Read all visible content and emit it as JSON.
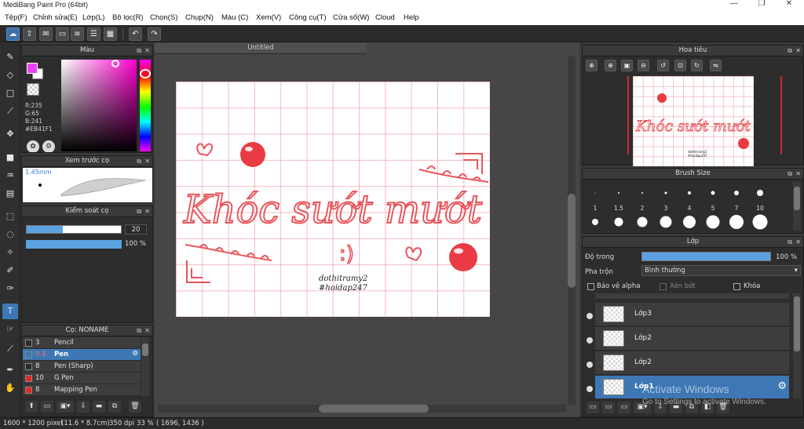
{
  "window": {
    "title": "MediBang Paint Pro (64bit)"
  },
  "menu": [
    "Tệp(F)",
    "Chỉnh sửa(E)",
    "Lớp(L)",
    "Bộ lọc(R)",
    "Chọn(S)",
    "Chụp(N)",
    "Màu (C)",
    "Xem(V)",
    "Công cụ(T)",
    "Cửa sổ(W)",
    "Cloud",
    "Help"
  ],
  "document": {
    "tab_title": "Untitled"
  },
  "color_panel": {
    "title": "Màu",
    "r": "R:235",
    "g": "G:65",
    "b": "B:241",
    "hex": "#EB41F1",
    "foreground": "#EB41F1"
  },
  "brush_preview": {
    "title": "Xem trước cọ",
    "size": "1.45mm"
  },
  "brush_control": {
    "title": "Kiểm soát cọ",
    "size_value": "20",
    "size_level": 0.38,
    "opacity_value": "100 %",
    "opacity_level": 1.0
  },
  "brush_list": {
    "title": "Cọ: NONAME",
    "items": [
      {
        "size": "3",
        "name": "Pencil",
        "color": "#2b2b2b"
      },
      {
        "size": "0.4",
        "name": "Pen",
        "color": "#3d78b5"
      },
      {
        "size": "8",
        "name": "Pen (Sharp)",
        "color": "#2b2b2b"
      },
      {
        "size": "10",
        "name": "G Pen",
        "color": "#e02a2a"
      },
      {
        "size": "8",
        "name": "Mapping Pen",
        "color": "#e02a2a"
      }
    ]
  },
  "artwork": {
    "text_main": "Khóc sướt mướt",
    "text_face": ":)",
    "credit_1": "dothitramy2",
    "credit_2": "#hoidap247",
    "ink_color": "#e8555c"
  },
  "navigator": {
    "title": "Hoa tiêu"
  },
  "brush_size": {
    "title": "Brush Size",
    "sizes": [
      "1",
      "1.5",
      "2",
      "3",
      "4",
      "5",
      "7",
      "10"
    ]
  },
  "layer_panel": {
    "title": "Lớp",
    "opacity_label": "Độ trong",
    "opacity_value": "100 %",
    "opacity_level": 1.0,
    "blend_label": "Pha trộn",
    "blend_value": "Bình thường",
    "protect_alpha": "Bảo vệ alpha",
    "clipping": "Xén bớt",
    "lock": "Khóa",
    "layers": [
      {
        "name": "Lớp3",
        "selected": false
      },
      {
        "name": "Lớp2",
        "selected": false
      },
      {
        "name": "Lớp2",
        "selected": false
      },
      {
        "name": "Lớp1",
        "selected": true
      }
    ]
  },
  "status": {
    "size": "1600 * 1200 pixel",
    "physical": "(11.6 * 8.7cm)",
    "dpi": "350 dpi",
    "zoom": "33 %",
    "coords": "( 1696, 1436 )"
  },
  "watermark": {
    "line1": "Activate Windows",
    "line2": "Go to Settings to activate Windows."
  }
}
